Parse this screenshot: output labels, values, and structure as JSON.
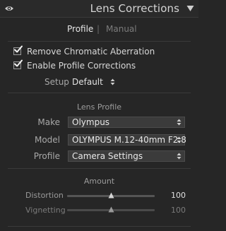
{
  "header": {
    "title": "Lens Corrections",
    "visibility_icon": "eye-icon",
    "collapse_icon": "triangle-down-icon"
  },
  "tabs": {
    "profile": "Profile",
    "separator": "|",
    "manual": "Manual",
    "active": "Profile"
  },
  "options": {
    "remove_chromatic_aberration": {
      "label": "Remove Chromatic Aberration",
      "checked": true
    },
    "enable_profile_corrections": {
      "label": "Enable Profile Corrections",
      "checked": true
    }
  },
  "setup": {
    "label": "Setup",
    "value": "Default"
  },
  "lens_profile": {
    "title": "Lens Profile",
    "make": {
      "label": "Make",
      "value": "Olympus"
    },
    "model": {
      "label": "Model",
      "value": "OLYMPUS M.12-40mm F2.8"
    },
    "profile": {
      "label": "Profile",
      "value": "Camera Settings"
    }
  },
  "amount": {
    "title": "Amount",
    "distortion": {
      "label": "Distortion",
      "value": "100",
      "level": 0.5
    },
    "vignetting": {
      "label": "Vignetting",
      "value": "100",
      "level": 0.5
    }
  },
  "colors": {
    "panel_bg": "#262626",
    "text": "#d8d8d8",
    "muted_text": "#8e8e8e",
    "dropdown_bg": "#3b3b3b"
  }
}
